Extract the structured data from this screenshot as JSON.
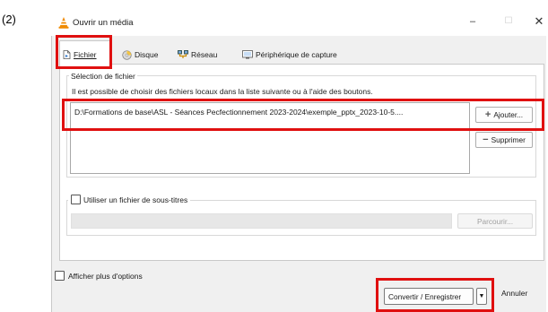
{
  "step_label": "(2)",
  "window": {
    "title": "Ouvrir un média",
    "minimize_symbol": "–",
    "maximize_symbol": "☐",
    "close_symbol": "✕"
  },
  "tabs": [
    {
      "label": "Fichier",
      "icon": "file-icon",
      "active": true
    },
    {
      "label": "Disque",
      "icon": "disc-icon",
      "active": false
    },
    {
      "label": "Réseau",
      "icon": "network-icon",
      "active": false
    },
    {
      "label": "Périphérique de capture",
      "icon": "capture-device-icon",
      "active": false
    }
  ],
  "file_selection": {
    "group_title": "Sélection de fichier",
    "help_text": "Il est possible de choisir des fichiers locaux dans la liste suivante ou à l'aide des boutons.",
    "files": [
      "D:\\Formations de base\\ASL - Séances Pecfectionnement 2023-2024\\exemple_pptx_2023-10-5...."
    ],
    "add_label": "Ajouter...",
    "remove_label": "Supprimer"
  },
  "subtitles": {
    "checkbox_label": "Utiliser un fichier de sous-titres",
    "checked": false,
    "browse_label": "Parcourir..."
  },
  "more_options": {
    "label": "Afficher plus d'options",
    "checked": false
  },
  "footer": {
    "convert_label": "Convertir / Enregistrer",
    "dropdown_symbol": "▼",
    "cancel_label": "Annuler"
  },
  "colors": {
    "highlight": "#e01010",
    "vlc_orange": "#f08a00"
  }
}
